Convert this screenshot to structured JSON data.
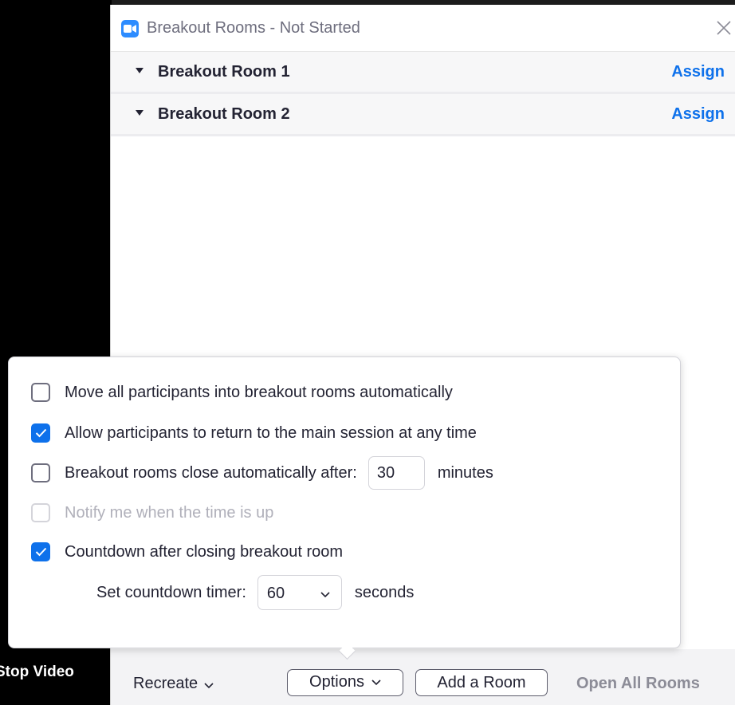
{
  "window": {
    "title": "Breakout Rooms - Not Started"
  },
  "rooms": [
    {
      "name": "Breakout Room 1",
      "action": "Assign"
    },
    {
      "name": "Breakout Room 2",
      "action": "Assign"
    }
  ],
  "options": {
    "items": [
      {
        "label": "Move all participants into breakout rooms automatically",
        "checked": false,
        "disabled": false
      },
      {
        "label": "Allow participants to return to the main session at any time",
        "checked": true,
        "disabled": false
      },
      {
        "label": "Breakout rooms close automatically after:",
        "checked": false,
        "disabled": false
      },
      {
        "label": "Notify me when the time is up",
        "checked": false,
        "disabled": true
      },
      {
        "label": "Countdown after closing breakout room",
        "checked": true,
        "disabled": false
      }
    ],
    "close_after_value": "30",
    "close_after_unit": "minutes",
    "countdown_label": "Set countdown timer:",
    "countdown_value": "60",
    "countdown_unit": "seconds"
  },
  "toolbar": {
    "recreate_label": "Recreate",
    "options_label": "Options",
    "add_room_label": "Add a Room",
    "open_all_label": "Open All Rooms"
  },
  "background": {
    "stop_video_label": "Stop Video"
  },
  "colors": {
    "accent": "#0e71eb",
    "brand": "#2d8cff",
    "disabled": "#b0b0ba"
  },
  "icons": [
    "zoom-app-icon",
    "close-icon",
    "caret-down-icon",
    "chevron-down-icon",
    "checkmark-icon"
  ]
}
